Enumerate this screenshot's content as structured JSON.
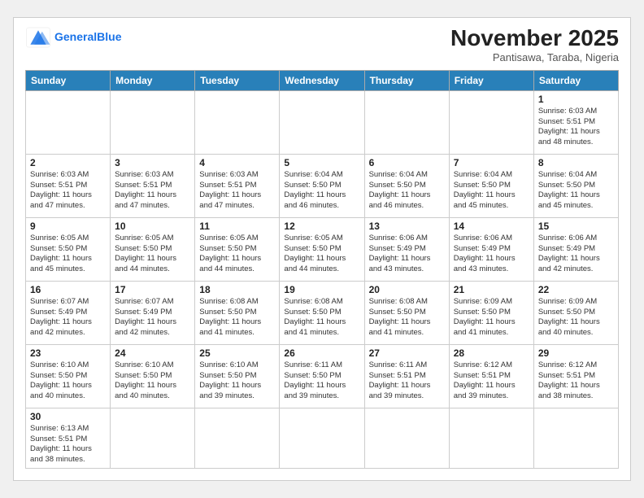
{
  "header": {
    "logo_general": "General",
    "logo_blue": "Blue",
    "month_title": "November 2025",
    "location": "Pantisawa, Taraba, Nigeria"
  },
  "weekdays": [
    "Sunday",
    "Monday",
    "Tuesday",
    "Wednesday",
    "Thursday",
    "Friday",
    "Saturday"
  ],
  "weeks": [
    [
      {
        "day": "",
        "info": ""
      },
      {
        "day": "",
        "info": ""
      },
      {
        "day": "",
        "info": ""
      },
      {
        "day": "",
        "info": ""
      },
      {
        "day": "",
        "info": ""
      },
      {
        "day": "",
        "info": ""
      },
      {
        "day": "1",
        "info": "Sunrise: 6:03 AM\nSunset: 5:51 PM\nDaylight: 11 hours\nand 48 minutes."
      }
    ],
    [
      {
        "day": "2",
        "info": "Sunrise: 6:03 AM\nSunset: 5:51 PM\nDaylight: 11 hours\nand 47 minutes."
      },
      {
        "day": "3",
        "info": "Sunrise: 6:03 AM\nSunset: 5:51 PM\nDaylight: 11 hours\nand 47 minutes."
      },
      {
        "day": "4",
        "info": "Sunrise: 6:03 AM\nSunset: 5:51 PM\nDaylight: 11 hours\nand 47 minutes."
      },
      {
        "day": "5",
        "info": "Sunrise: 6:04 AM\nSunset: 5:50 PM\nDaylight: 11 hours\nand 46 minutes."
      },
      {
        "day": "6",
        "info": "Sunrise: 6:04 AM\nSunset: 5:50 PM\nDaylight: 11 hours\nand 46 minutes."
      },
      {
        "day": "7",
        "info": "Sunrise: 6:04 AM\nSunset: 5:50 PM\nDaylight: 11 hours\nand 45 minutes."
      },
      {
        "day": "8",
        "info": "Sunrise: 6:04 AM\nSunset: 5:50 PM\nDaylight: 11 hours\nand 45 minutes."
      }
    ],
    [
      {
        "day": "9",
        "info": "Sunrise: 6:05 AM\nSunset: 5:50 PM\nDaylight: 11 hours\nand 45 minutes."
      },
      {
        "day": "10",
        "info": "Sunrise: 6:05 AM\nSunset: 5:50 PM\nDaylight: 11 hours\nand 44 minutes."
      },
      {
        "day": "11",
        "info": "Sunrise: 6:05 AM\nSunset: 5:50 PM\nDaylight: 11 hours\nand 44 minutes."
      },
      {
        "day": "12",
        "info": "Sunrise: 6:05 AM\nSunset: 5:50 PM\nDaylight: 11 hours\nand 44 minutes."
      },
      {
        "day": "13",
        "info": "Sunrise: 6:06 AM\nSunset: 5:49 PM\nDaylight: 11 hours\nand 43 minutes."
      },
      {
        "day": "14",
        "info": "Sunrise: 6:06 AM\nSunset: 5:49 PM\nDaylight: 11 hours\nand 43 minutes."
      },
      {
        "day": "15",
        "info": "Sunrise: 6:06 AM\nSunset: 5:49 PM\nDaylight: 11 hours\nand 42 minutes."
      }
    ],
    [
      {
        "day": "16",
        "info": "Sunrise: 6:07 AM\nSunset: 5:49 PM\nDaylight: 11 hours\nand 42 minutes."
      },
      {
        "day": "17",
        "info": "Sunrise: 6:07 AM\nSunset: 5:49 PM\nDaylight: 11 hours\nand 42 minutes."
      },
      {
        "day": "18",
        "info": "Sunrise: 6:08 AM\nSunset: 5:50 PM\nDaylight: 11 hours\nand 41 minutes."
      },
      {
        "day": "19",
        "info": "Sunrise: 6:08 AM\nSunset: 5:50 PM\nDaylight: 11 hours\nand 41 minutes."
      },
      {
        "day": "20",
        "info": "Sunrise: 6:08 AM\nSunset: 5:50 PM\nDaylight: 11 hours\nand 41 minutes."
      },
      {
        "day": "21",
        "info": "Sunrise: 6:09 AM\nSunset: 5:50 PM\nDaylight: 11 hours\nand 41 minutes."
      },
      {
        "day": "22",
        "info": "Sunrise: 6:09 AM\nSunset: 5:50 PM\nDaylight: 11 hours\nand 40 minutes."
      }
    ],
    [
      {
        "day": "23",
        "info": "Sunrise: 6:10 AM\nSunset: 5:50 PM\nDaylight: 11 hours\nand 40 minutes."
      },
      {
        "day": "24",
        "info": "Sunrise: 6:10 AM\nSunset: 5:50 PM\nDaylight: 11 hours\nand 40 minutes."
      },
      {
        "day": "25",
        "info": "Sunrise: 6:10 AM\nSunset: 5:50 PM\nDaylight: 11 hours\nand 39 minutes."
      },
      {
        "day": "26",
        "info": "Sunrise: 6:11 AM\nSunset: 5:50 PM\nDaylight: 11 hours\nand 39 minutes."
      },
      {
        "day": "27",
        "info": "Sunrise: 6:11 AM\nSunset: 5:51 PM\nDaylight: 11 hours\nand 39 minutes."
      },
      {
        "day": "28",
        "info": "Sunrise: 6:12 AM\nSunset: 5:51 PM\nDaylight: 11 hours\nand 39 minutes."
      },
      {
        "day": "29",
        "info": "Sunrise: 6:12 AM\nSunset: 5:51 PM\nDaylight: 11 hours\nand 38 minutes."
      }
    ],
    [
      {
        "day": "30",
        "info": "Sunrise: 6:13 AM\nSunset: 5:51 PM\nDaylight: 11 hours\nand 38 minutes."
      },
      {
        "day": "",
        "info": ""
      },
      {
        "day": "",
        "info": ""
      },
      {
        "day": "",
        "info": ""
      },
      {
        "day": "",
        "info": ""
      },
      {
        "day": "",
        "info": ""
      },
      {
        "day": "",
        "info": ""
      }
    ]
  ]
}
